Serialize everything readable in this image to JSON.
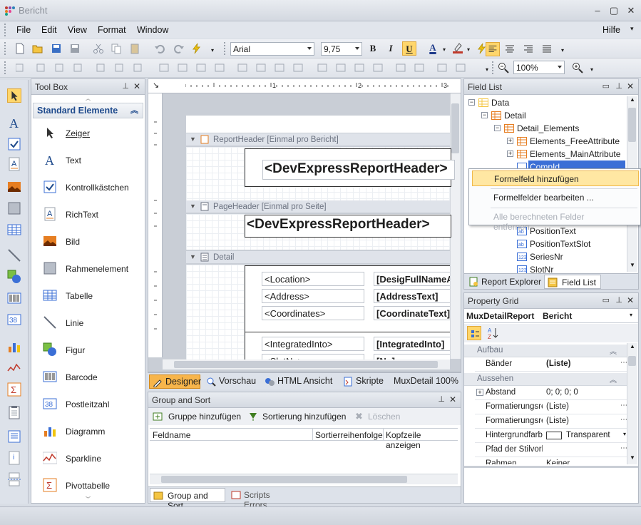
{
  "window": {
    "title": "Bericht",
    "min": "–",
    "max": "▢",
    "close": "✕"
  },
  "menu": {
    "items": [
      "File",
      "Edit",
      "View",
      "Format",
      "Window"
    ],
    "help": "Hilfe"
  },
  "format_toolbar": {
    "font": "Arial",
    "size": "9,75",
    "bold": "B",
    "italic": "I",
    "underline": "U",
    "fore_color": "A"
  },
  "layout_toolbar": {
    "zoom": "100%"
  },
  "toolbox": {
    "title": "Tool Box",
    "category": "Standard Elemente",
    "items": [
      {
        "label": "Zeiger",
        "icon": "pointer-icon"
      },
      {
        "label": "Text",
        "icon": "text-icon"
      },
      {
        "label": "Kontrollkästchen",
        "icon": "checkbox-icon"
      },
      {
        "label": "RichText",
        "icon": "richtext-icon"
      },
      {
        "label": "Bild",
        "icon": "picture-icon"
      },
      {
        "label": "Rahmenelement",
        "icon": "panel-icon"
      },
      {
        "label": "Tabelle",
        "icon": "table-icon"
      },
      {
        "label": "Linie",
        "icon": "line-icon"
      },
      {
        "label": "Figur",
        "icon": "shape-icon"
      },
      {
        "label": "Barcode",
        "icon": "barcode-icon"
      },
      {
        "label": "Postleitzahl",
        "icon": "zipcode-icon"
      },
      {
        "label": "Diagramm",
        "icon": "chart-icon"
      },
      {
        "label": "Sparkline",
        "icon": "sparkline-icon"
      },
      {
        "label": "Pivottabelle",
        "icon": "pivot-icon"
      }
    ]
  },
  "ruler": {
    "marks": [
      "1",
      "2",
      "3"
    ]
  },
  "bands": {
    "report_header": {
      "label": "ReportHeader [Einmal pro Bericht]",
      "text": "<DevExpressReportHeader>"
    },
    "page_header": {
      "label": "PageHeader [Einmal pro Seite]",
      "text": "<DevExpressReportHeader>"
    },
    "detail": {
      "label": "Detail",
      "rows": [
        {
          "left": "<Location>",
          "right": "[DesigFullNameAt]"
        },
        {
          "left": "<Address>",
          "right": "[AddressText]"
        },
        {
          "left": "<Coordinates>",
          "right": "[CoordinateText]"
        },
        {
          "left": "<IntegratedInto>",
          "right": "[IntegratedInto]"
        },
        {
          "left": "<SlotNo>",
          "right": "[No]"
        }
      ]
    }
  },
  "designer_tabs": [
    "Designer",
    "Vorschau",
    "HTML Ansicht",
    "Skripte",
    "MuxDetail",
    "100%"
  ],
  "group_sort": {
    "title": "Group and Sort",
    "add_group": "Gruppe hinzufügen",
    "add_sort": "Sortierung hinzufügen",
    "delete": "Löschen",
    "columns": [
      "Feldname",
      "Sortierreihenfolge",
      "Kopfzeile anzeigen"
    ],
    "tabs": [
      "Group and Sort",
      "Scripts Errors"
    ]
  },
  "field_list": {
    "title": "Field List",
    "nodes": [
      {
        "label": "Data",
        "level": 0,
        "exp": "−"
      },
      {
        "label": "Detail",
        "level": 1,
        "exp": "−"
      },
      {
        "label": "Detail_Elements",
        "level": 2,
        "exp": "−"
      },
      {
        "label": "Elements_FreeAttribute",
        "level": 3,
        "exp": "+"
      },
      {
        "label": "Elements_MainAttribute",
        "level": 3,
        "exp": "+"
      },
      {
        "label": "CompId",
        "level": 3,
        "exp": ""
      },
      {
        "label": "PositionText",
        "level": 3,
        "exp": ""
      },
      {
        "label": "PositionTextSlot",
        "level": 3,
        "exp": ""
      },
      {
        "label": "SeriesNr",
        "level": 3,
        "exp": ""
      },
      {
        "label": "SlotNr",
        "level": 3,
        "exp": ""
      }
    ],
    "tabs": [
      "Report Explorer",
      "Field List"
    ]
  },
  "context_menu": {
    "items": [
      "Formelfeld hinzufügen",
      "Formelfelder bearbeiten ...",
      "Alle berechneten Felder entfernen"
    ]
  },
  "property_grid": {
    "title": "Property Grid",
    "selector_name": "MuxDetailReport",
    "selector_type": "Bericht",
    "categories": [
      "Aufbau",
      "Aussehen"
    ],
    "rows_aufbau": [
      {
        "name": "Bänder",
        "value": "(Liste)"
      }
    ],
    "rows_aussehen": [
      {
        "name": "Abstand",
        "value": "0; 0; 0; 0"
      },
      {
        "name": "Formatierungsre",
        "value": "(Liste)"
      },
      {
        "name": "Formatierungsre",
        "value": "(Liste)"
      },
      {
        "name": "Hintergrundfarbe",
        "value": "Transparent"
      },
      {
        "name": "Pfad der Stilvorla",
        "value": ""
      },
      {
        "name": "Rahmen",
        "value": "Keiner"
      }
    ]
  },
  "colors": {
    "accent": "#ffd66b",
    "selection": "#3b6fd6",
    "link": "#1e4a8c"
  }
}
